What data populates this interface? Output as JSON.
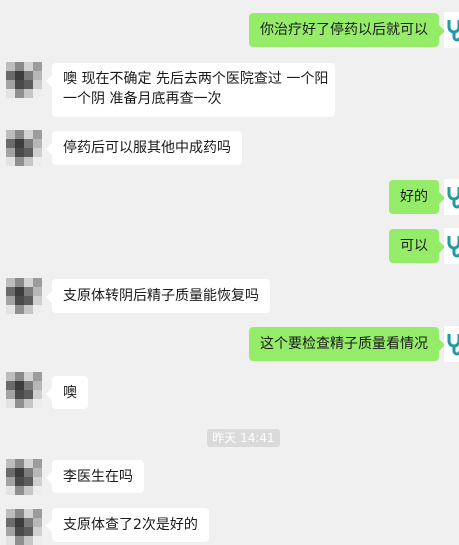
{
  "chat": {
    "messages": [
      {
        "side": "right",
        "text": "你治疗好了停药以后就可以"
      },
      {
        "side": "left",
        "lines": [
          "噢 现在不确定 先后去两个医院查过 一个阳",
          "一个阴 准备月底再查一次"
        ]
      },
      {
        "side": "left",
        "text": "停药后可以服其他中成药吗"
      },
      {
        "side": "right",
        "text": "好的"
      },
      {
        "side": "right",
        "text": "可以"
      },
      {
        "side": "left",
        "text": "支原体转阴后精子质量能恢复吗"
      },
      {
        "side": "right",
        "text": "这个要检查精子质量看情况"
      },
      {
        "side": "left",
        "text": "噢"
      },
      {
        "side": "left",
        "text": "李医生在吗"
      },
      {
        "side": "left",
        "text": "支原体查了2次是好的"
      }
    ],
    "timestamp": "昨天 14:41"
  },
  "colors": {
    "background": "#f0f0f0",
    "incoming_bubble": "#ffffff",
    "outgoing_bubble": "#95ec69",
    "doctor_avatar_icon": "#1f9aa0"
  },
  "icons": {
    "doctor_avatar": "stethoscope-icon"
  }
}
